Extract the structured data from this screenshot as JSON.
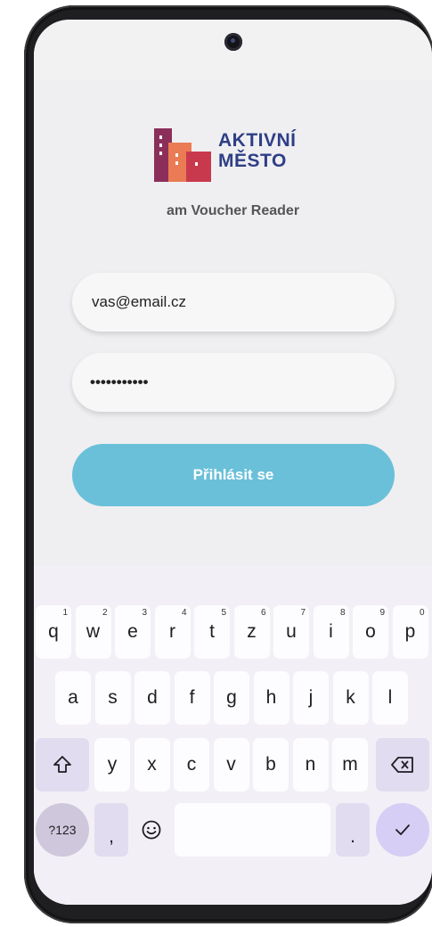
{
  "app": {
    "brand_line1": "AKTIVNÍ",
    "brand_line2": "MĚSTO",
    "subtitle": "am Voucher Reader"
  },
  "login": {
    "email_value": "vas@email.cz",
    "password_value": "•••••••••••",
    "submit_label": "Přihlásit se"
  },
  "keyboard": {
    "row1": [
      {
        "key": "q",
        "hint": "1"
      },
      {
        "key": "w",
        "hint": "2"
      },
      {
        "key": "e",
        "hint": "3"
      },
      {
        "key": "r",
        "hint": "4"
      },
      {
        "key": "t",
        "hint": "5"
      },
      {
        "key": "z",
        "hint": "6"
      },
      {
        "key": "u",
        "hint": "7"
      },
      {
        "key": "i",
        "hint": "8"
      },
      {
        "key": "o",
        "hint": "9"
      },
      {
        "key": "p",
        "hint": "0"
      }
    ],
    "row2": [
      "a",
      "s",
      "d",
      "f",
      "g",
      "h",
      "j",
      "k",
      "l"
    ],
    "row3": [
      "y",
      "x",
      "c",
      "v",
      "b",
      "n",
      "m"
    ],
    "symbols_label": "?123",
    "comma_label": ",",
    "period_label": "."
  },
  "colors": {
    "brand_blue": "#2e3e86",
    "button": "#6ac0d9",
    "logo_purple": "#8b2f5a",
    "logo_orange": "#ea7b54",
    "logo_red": "#c9394e"
  },
  "icons": [
    "camera-icon",
    "logo-buildings-icon",
    "shift-icon",
    "backspace-icon",
    "emoji-icon",
    "check-icon"
  ]
}
